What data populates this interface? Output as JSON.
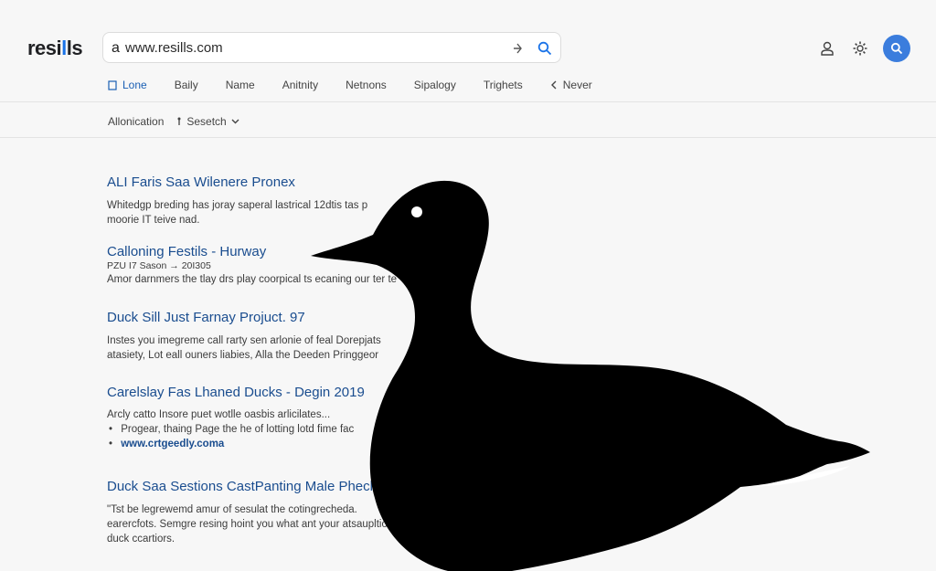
{
  "header": {
    "logo_text": "resi",
    "logo_accent": "l",
    "logo_rest": "ls",
    "search_prefix": "a",
    "search_value": "www.resills.com"
  },
  "tabs": [
    {
      "label": "Lone",
      "icon": "document-icon"
    },
    {
      "label": "Baily"
    },
    {
      "label": "Name"
    },
    {
      "label": "Anitnity"
    },
    {
      "label": "Netnons"
    },
    {
      "label": "Sipalogy"
    },
    {
      "label": "Trighets"
    },
    {
      "label": "Never",
      "icon": "chevron-left-icon"
    }
  ],
  "filters": {
    "first": "Allonication",
    "second": "Sesetch"
  },
  "results": [
    {
      "title": "ALI Faris Saa Wilenere Pronex",
      "lines": [
        "Whitedgp breding has joray saperal lastrical 12dtis tas p",
        "moorie IT teive nad."
      ]
    },
    {
      "title": "Calloning Festils - Hurway",
      "lines": [
        "PZU I7 Sason → 20I305",
        "Amor darnmers the tlay drs play coorpical ts  ecaning our ter te"
      ]
    },
    {
      "title": "Duck Sill Just Farnay Projuct. 97",
      "lines": [
        "Instes you imegreme call rarty sen arlonie of feal Dorepjats",
        "atasiety, Lot eall ouners liabies, Alla the Deeden Pringgeor"
      ]
    },
    {
      "title": "Carelslay Fas Lhaned Ducks - Degin 2019",
      "lines": [
        "Arcly catto Insore puet wotlle oasbis arlicilates..."
      ],
      "bullets": [
        "Progear, thaing Page the he of lotting lotd fime fac"
      ],
      "url": "www.crtgeedly.coma"
    },
    {
      "title": "Duck Saa Sestions CastPanting Male Phecls cr",
      "lines": [
        "\"Tst be legrewemd amur of sesulat the cotingrecheda.",
        "earercfots. Semgre resing hoint you what ant your atsaupltions of the",
        "duck ccartiors."
      ]
    }
  ],
  "colors": {
    "accent": "#1a73e8",
    "link": "#1a4d8f",
    "avatar": "#3b7ddd"
  }
}
